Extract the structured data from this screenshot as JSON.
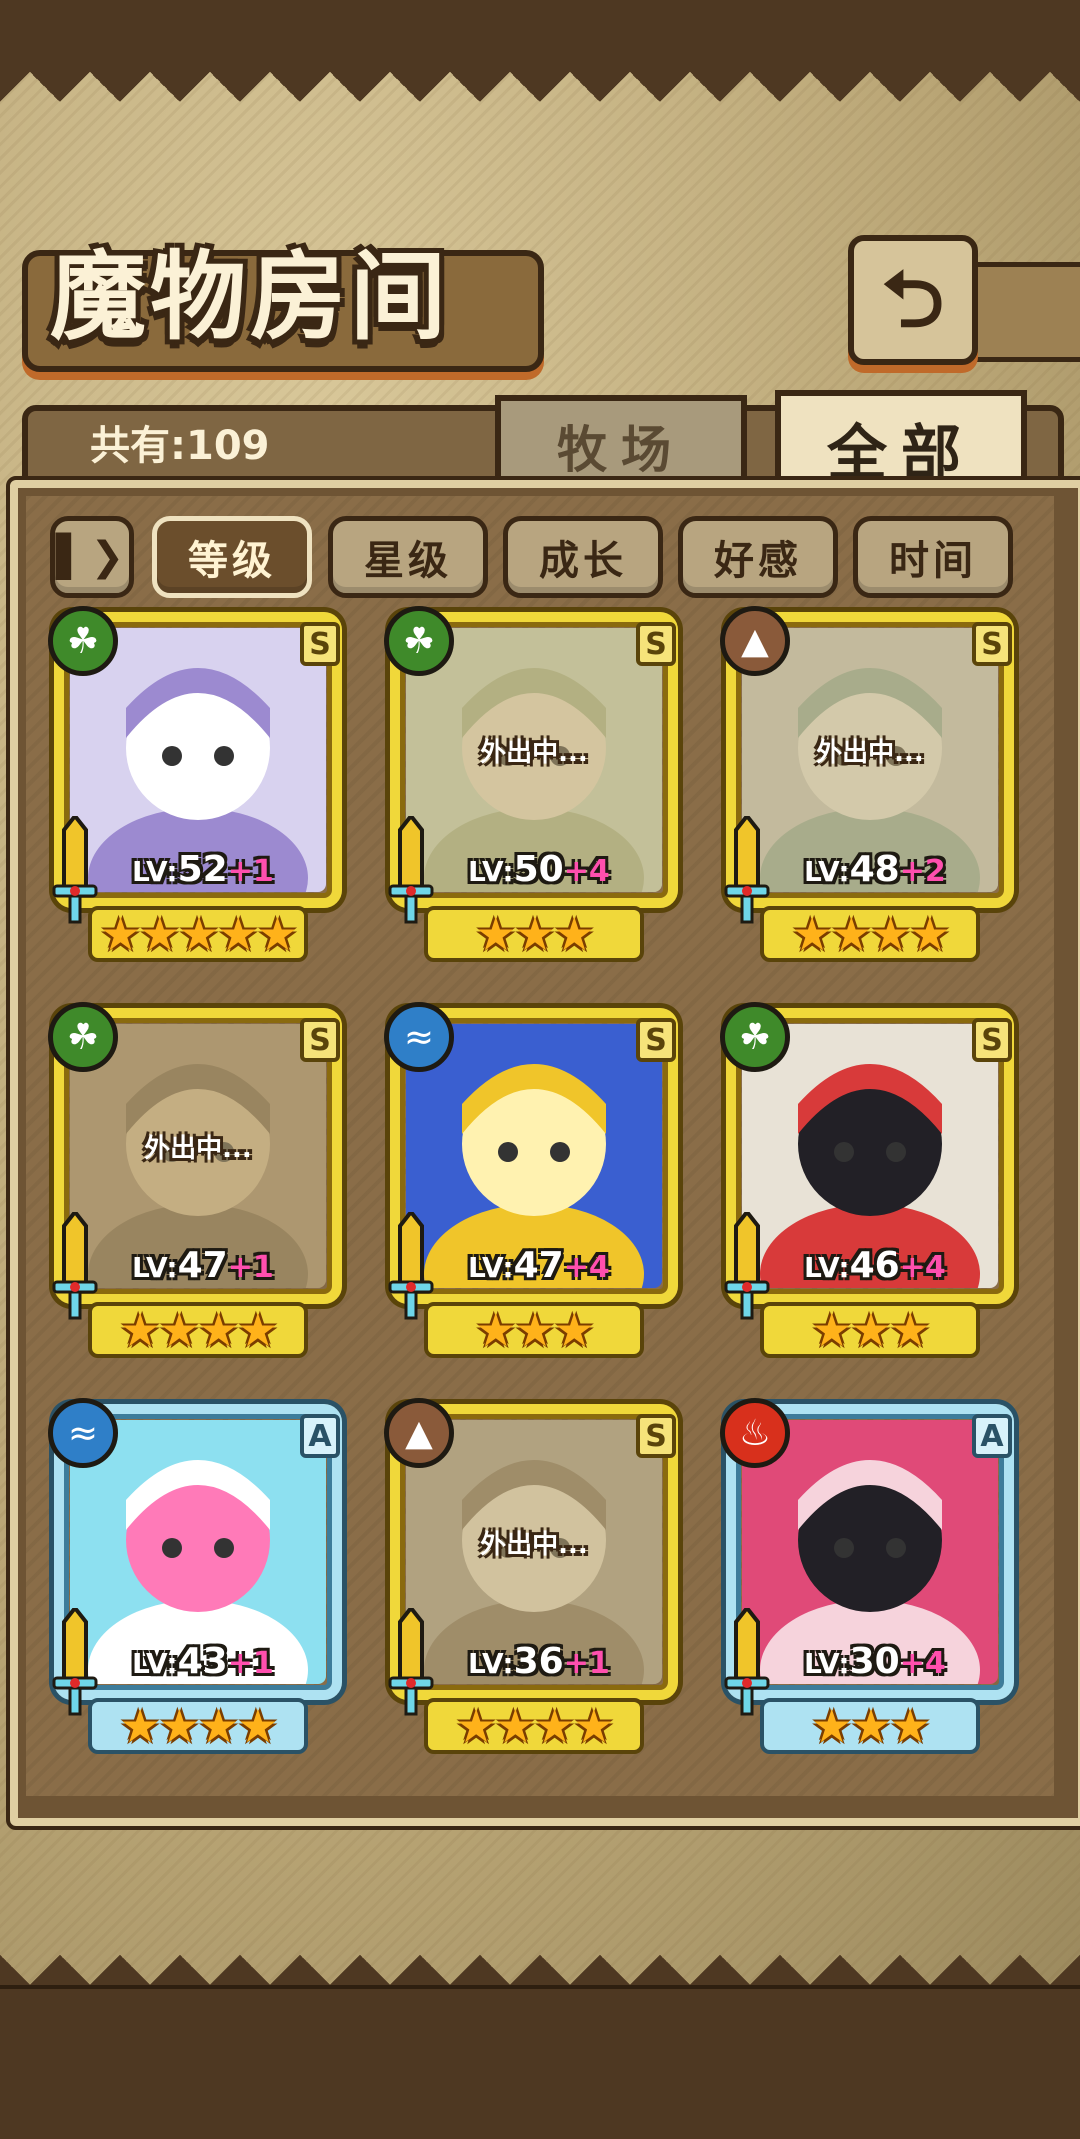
{
  "header": {
    "title": "魔物房间",
    "back_icon": "back-arrow-icon"
  },
  "summary": {
    "count_text": "共有:109"
  },
  "tabs": [
    {
      "label": "牧场",
      "active": false
    },
    {
      "label": "全部",
      "active": true
    }
  ],
  "sort": {
    "toggle_icon": "sort-order-icon",
    "options": [
      {
        "label": "等级",
        "active": true
      },
      {
        "label": "星级",
        "active": false
      },
      {
        "label": "成长",
        "active": false
      },
      {
        "label": "好感",
        "active": false
      },
      {
        "label": "时间",
        "active": false
      }
    ]
  },
  "colors": {
    "gold_frame": "#f0d83a",
    "blue_frame": "#aee2f2",
    "bonus_pink": "#ff4fae"
  },
  "monsters": [
    {
      "element": "grass",
      "rank": "S",
      "level": "52",
      "bonus": "+1",
      "stars": 5,
      "away": false,
      "away_text": ""
    },
    {
      "element": "grass",
      "rank": "S",
      "level": "50",
      "bonus": "+4",
      "stars": 3,
      "away": true,
      "away_text": "外出中..."
    },
    {
      "element": "earth",
      "rank": "S",
      "level": "48",
      "bonus": "+2",
      "stars": 4,
      "away": true,
      "away_text": "外出中..."
    },
    {
      "element": "grass",
      "rank": "S",
      "level": "47",
      "bonus": "+1",
      "stars": 4,
      "away": true,
      "away_text": "外出中..."
    },
    {
      "element": "water",
      "rank": "S",
      "level": "47",
      "bonus": "+4",
      "stars": 3,
      "away": false,
      "away_text": ""
    },
    {
      "element": "grass",
      "rank": "S",
      "level": "46",
      "bonus": "+4",
      "stars": 3,
      "away": false,
      "away_text": ""
    },
    {
      "element": "water",
      "rank": "A",
      "level": "43",
      "bonus": "+1",
      "stars": 4,
      "away": false,
      "away_text": ""
    },
    {
      "element": "earth",
      "rank": "S",
      "level": "36",
      "bonus": "+1",
      "stars": 4,
      "away": true,
      "away_text": "外出中..."
    },
    {
      "element": "fire",
      "rank": "A",
      "level": "30",
      "bonus": "+4",
      "stars": 3,
      "away": false,
      "away_text": ""
    }
  ]
}
